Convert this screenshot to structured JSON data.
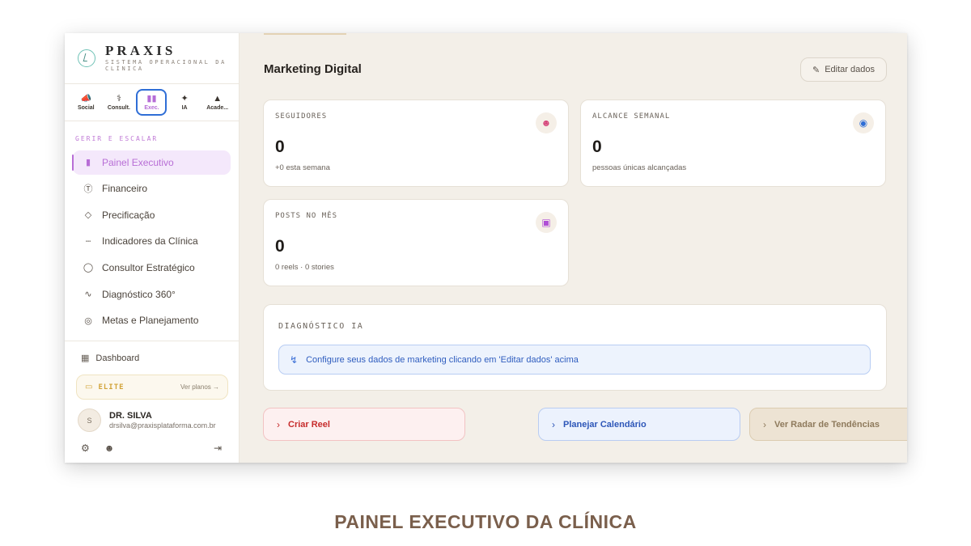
{
  "brand": {
    "name": "PRAXIS",
    "subtitle": "SISTEMA OPERACIONAL DA CLÍNICA"
  },
  "module_tabs": [
    {
      "label": "Social",
      "icon": "megaphone-icon",
      "active": false
    },
    {
      "label": "Consult.",
      "icon": "stethoscope-icon",
      "active": false
    },
    {
      "label": "Exec.",
      "icon": "bar-chart-icon",
      "active": true
    },
    {
      "label": "IA",
      "icon": "sparkles-icon",
      "active": false
    },
    {
      "label": "Acade...",
      "icon": "graduation-cap-icon",
      "active": false
    }
  ],
  "sidebar": {
    "section_label": "GERIR E ESCALAR",
    "items": [
      {
        "label": "Painel Executivo",
        "icon": "bar-chart-icon",
        "active": true
      },
      {
        "label": "Financeiro",
        "icon": "dollar-circle-icon",
        "active": false
      },
      {
        "label": "Precificação",
        "icon": "tag-icon",
        "active": false
      },
      {
        "label": "Indicadores da Clínica",
        "icon": "bar-chart-icon",
        "active": false
      },
      {
        "label": "Consultor Estratégico",
        "icon": "lightbulb-icon",
        "active": false
      },
      {
        "label": "Diagnóstico 360°",
        "icon": "activity-icon",
        "active": false
      },
      {
        "label": "Metas e Planejamento",
        "icon": "target-icon",
        "active": false
      }
    ],
    "dashboard_label": "Dashboard",
    "plan": {
      "tier": "ELITE",
      "link": "Ver planos →"
    },
    "user": {
      "initial": "S",
      "name": "DR. SILVA",
      "email": "drsilva@praxisplataforma.com.br"
    }
  },
  "main": {
    "title": "Marketing Digital",
    "edit_label": "Editar dados",
    "stats": [
      {
        "label": "SEGUIDORES",
        "value": "0",
        "sub": "+0 esta semana",
        "icon": "users-icon",
        "icon_color": "#d6457a"
      },
      {
        "label": "ALCANCE SEMANAL",
        "value": "0",
        "sub": "pessoas únicas alcançadas",
        "icon": "eye-icon",
        "icon_color": "#2f6ed6"
      },
      {
        "label": "POSTS NO MÊS",
        "value": "0",
        "sub": "0 reels · 0 stories",
        "icon": "camera-icon",
        "icon_color": "#b04fd6"
      }
    ],
    "diagnostic": {
      "label": "DIAGNÓSTICO IA",
      "message": "Configure seus dados de marketing clicando em 'Editar dados' acima"
    },
    "actions": [
      {
        "label": "Criar Reel"
      },
      {
        "label": "Planejar Calendário"
      },
      {
        "label": "Ver Radar de Tendências"
      }
    ]
  },
  "caption": "PAINEL EXECUTIVO DA CLÍNICA"
}
